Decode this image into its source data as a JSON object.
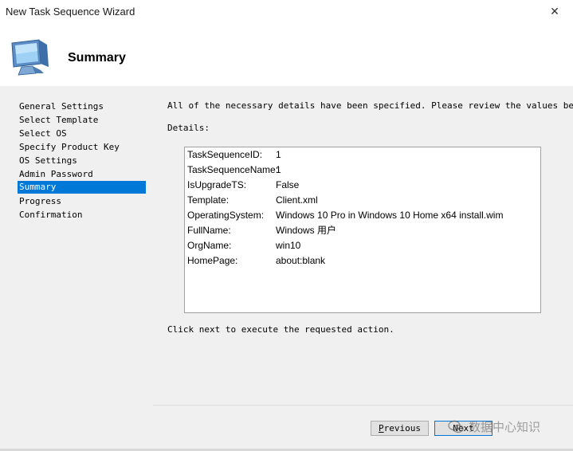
{
  "window": {
    "title": "New Task Sequence Wizard",
    "close_glyph": "✕"
  },
  "header": {
    "title": "Summary",
    "icon": "computer-monitor-icon"
  },
  "nav": {
    "items": [
      {
        "label": "General Settings",
        "selected": false
      },
      {
        "label": "Select Template",
        "selected": false
      },
      {
        "label": "Select OS",
        "selected": false
      },
      {
        "label": "Specify Product Key",
        "selected": false
      },
      {
        "label": "OS Settings",
        "selected": false
      },
      {
        "label": "Admin Password",
        "selected": false
      },
      {
        "label": "Summary",
        "selected": true
      },
      {
        "label": "Progress",
        "selected": false
      },
      {
        "label": "Confirmation",
        "selected": false
      }
    ]
  },
  "main": {
    "intro": "All of the necessary details have been specified.  Please review the values below.",
    "details_label": "Details:",
    "details": [
      {
        "key": "TaskSequenceID:",
        "value": "1"
      },
      {
        "key": "TaskSequenceName:",
        "value": "1"
      },
      {
        "key": "IsUpgradeTS:",
        "value": "False"
      },
      {
        "key": "Template:",
        "value": "Client.xml"
      },
      {
        "key": "OperatingSystem:",
        "value": "Windows 10 Pro in Windows 10 Home x64 install.wim"
      },
      {
        "key": "FullName:",
        "value": "Windows 用户"
      },
      {
        "key": "OrgName:",
        "value": "win10"
      },
      {
        "key": "HomePage:",
        "value": "about:blank"
      }
    ],
    "footer": "Click next to execute the requested action."
  },
  "buttons": {
    "previous": "Previous",
    "next": "Next"
  },
  "watermark": {
    "text": "数据中心知识"
  },
  "colors": {
    "selection": "#0078d7",
    "panel_bg": "#f0f0f0"
  }
}
